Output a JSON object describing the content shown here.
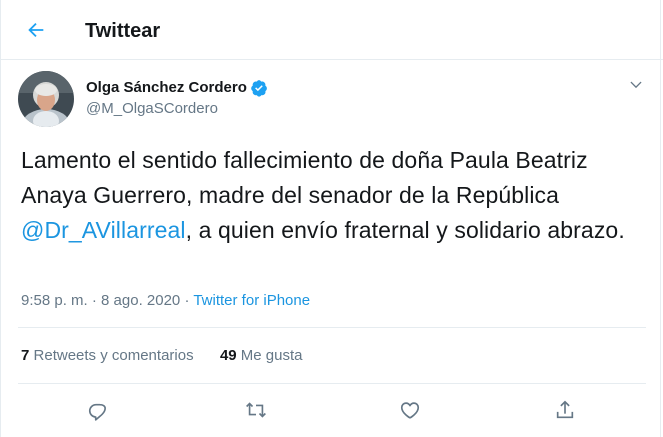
{
  "header": {
    "title": "Twittear",
    "back_icon": "arrow-left-icon"
  },
  "author": {
    "name": "Olga Sánchez Cordero",
    "handle": "@M_OlgaSCordero",
    "verified": true
  },
  "tweet": {
    "text_before": "Lamento el sentido fallecimiento de doña Paula Beatriz Anaya Guerrero, madre del senador de la República ",
    "mention": "@Dr_AVillarreal",
    "text_after": ", a quien envío fraternal y solidario abrazo.",
    "time": "9:58 p. m. · 8 ago. 2020",
    "separator": " · ",
    "source": "Twitter for iPhone"
  },
  "stats": {
    "retweets_count": "7",
    "retweets_label": "Retweets y comentarios",
    "likes_count": "49",
    "likes_label": "Me gusta"
  },
  "actions": [
    "reply-icon",
    "retweet-icon",
    "like-icon",
    "share-icon"
  ],
  "colors": {
    "accent": "#1da1f2",
    "link": "#1b95e0",
    "secondary": "#657786",
    "border": "#e6ecf0"
  }
}
